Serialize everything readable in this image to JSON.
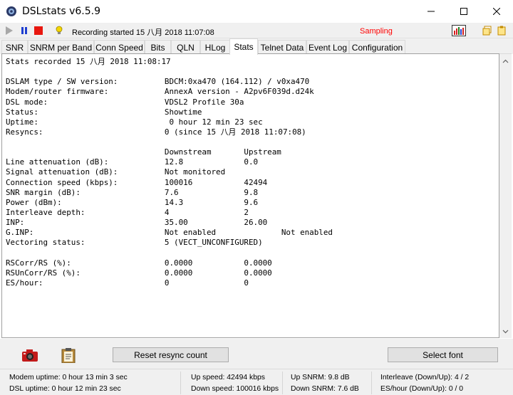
{
  "window": {
    "title": "DSLstats v6.5.9",
    "controls": [
      "minimize",
      "maximize",
      "close"
    ]
  },
  "toolbar": {
    "status_text": "Recording started 15 八月 2018 11:07:08",
    "sampling_text": "Sampling",
    "sampling_color": "#ff0000",
    "icons": [
      "play-icon",
      "pause-icon",
      "stop-icon",
      "tip-bulb-icon",
      "chart-icon",
      "copy-icon",
      "paste-icon"
    ]
  },
  "tabs": [
    {
      "label": "SNR",
      "active": false
    },
    {
      "label": "SNRM per Band",
      "active": false
    },
    {
      "label": "Conn Speed",
      "active": false
    },
    {
      "label": "Bits",
      "active": false
    },
    {
      "label": "QLN",
      "active": false
    },
    {
      "label": "HLog",
      "active": false
    },
    {
      "label": "Stats",
      "active": true
    },
    {
      "label": "Telnet Data",
      "active": false
    },
    {
      "label": "Event Log",
      "active": false
    },
    {
      "label": "Configuration",
      "active": false
    }
  ],
  "stats": {
    "recorded_line": "Stats recorded 15 八月 2018 11:08:17",
    "rows_a": [
      {
        "label": "DSLAM type / SW version:",
        "value": "BDCM:0xa470 (164.112) / v0xa470"
      },
      {
        "label": "Modem/router firmware:",
        "value": "AnnexA version - A2pv6F039d.d24k"
      },
      {
        "label": "DSL mode:",
        "value": "VDSL2 Profile 30a"
      },
      {
        "label": "Status:",
        "value": "Showtime"
      },
      {
        "label": "Uptime:",
        "value": " 0 hour 12 min 23 sec"
      },
      {
        "label": "Resyncs:",
        "value": "0 (since 15 八月 2018 11:07:08)"
      }
    ],
    "col_headers": {
      "downstream": "Downstream",
      "upstream": "Upstream"
    },
    "rows_b": [
      {
        "label": "Line attenuation (dB):",
        "down": "12.8",
        "up": "0.0"
      },
      {
        "label": "Signal attenuation (dB):",
        "down": "Not monitored",
        "up": ""
      },
      {
        "label": "Connection speed (kbps):",
        "down": "100016",
        "up": "42494"
      },
      {
        "label": "SNR margin (dB):",
        "down": "7.6",
        "up": "9.8"
      },
      {
        "label": "Power (dBm):",
        "down": "14.3",
        "up": "9.6"
      },
      {
        "label": "Interleave depth:",
        "down": "4",
        "up": "2"
      },
      {
        "label": "INP:",
        "down": "35.00",
        "up": "26.00"
      },
      {
        "label": "G.INP:",
        "down": "Not enabled",
        "up": "Not enabled"
      },
      {
        "label": "Vectoring status:",
        "down": "5 (VECT_UNCONFIGURED)",
        "up": ""
      }
    ],
    "rows_c": [
      {
        "label": "RSCorr/RS (%):",
        "down": "0.0000",
        "up": "0.0000"
      },
      {
        "label": "RSUnCorr/RS (%):",
        "down": "0.0000",
        "up": "0.0000"
      },
      {
        "label": "ES/hour:",
        "down": "0",
        "up": "0"
      }
    ]
  },
  "buttons": {
    "reset_label": "Reset resync count",
    "font_label": "Select font",
    "icons": [
      "camera-icon",
      "clipboard-icon"
    ]
  },
  "statusbar": {
    "modem_uptime": "Modem uptime:  0 hour 13 min 3 sec",
    "dsl_uptime": "DSL uptime:  0 hour 12 min 23 sec",
    "up_speed": "Up speed: 42494 kbps",
    "down_speed": "Down speed: 100016 kbps",
    "up_snrm": "Up SNRM: 9.8 dB",
    "down_snrm": "Down SNRM: 7.6 dB",
    "interleave": "Interleave (Down/Up): 4 / 2",
    "es_hour": "ES/hour (Down/Up): 0 / 0"
  }
}
